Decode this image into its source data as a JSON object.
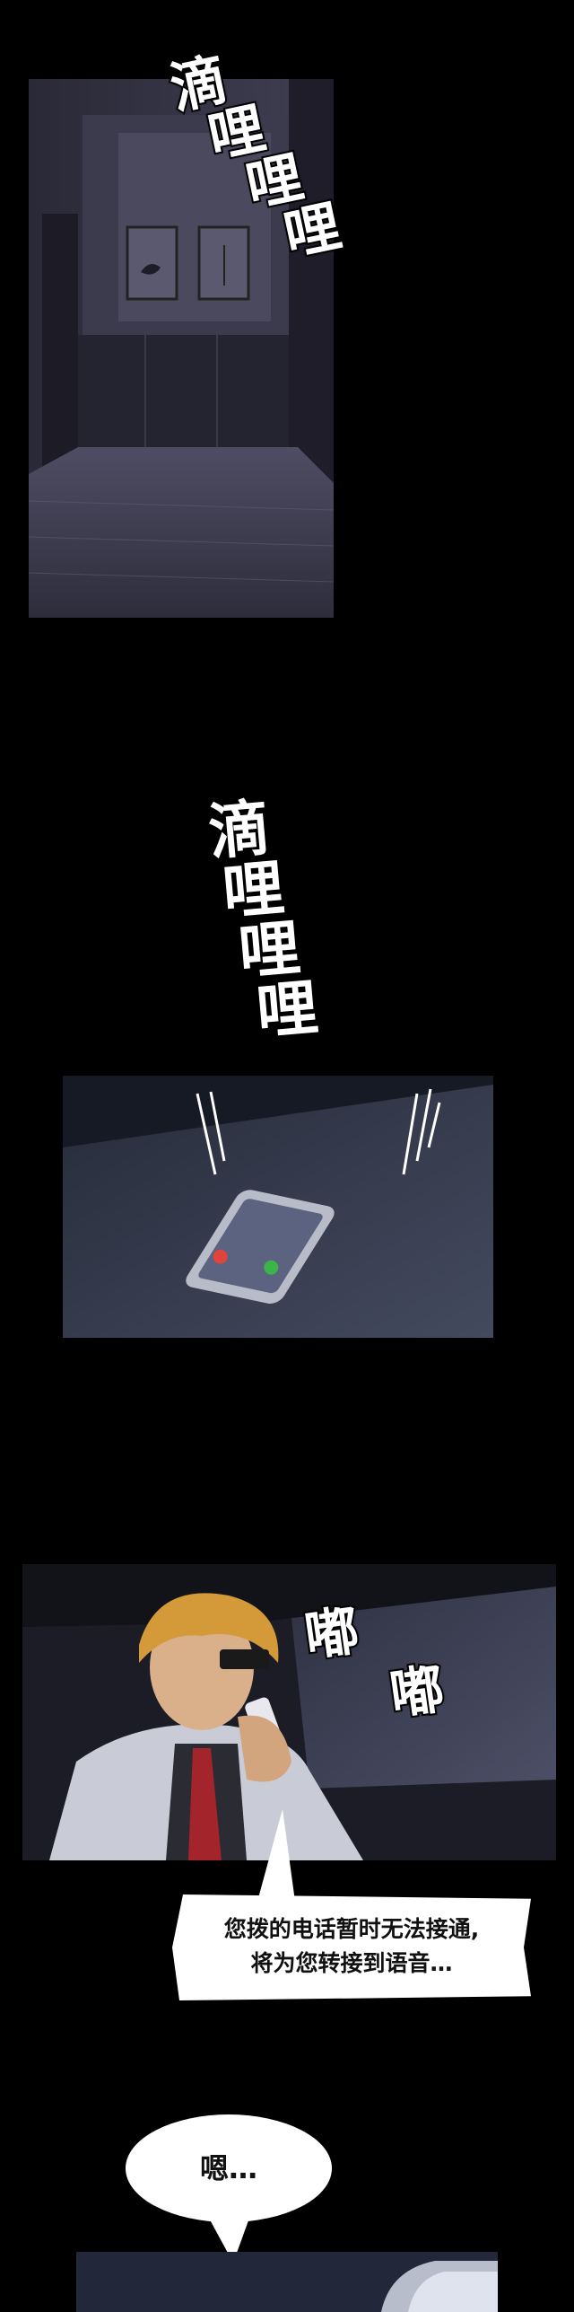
{
  "page": {
    "background": "#000000"
  },
  "panels": [
    {
      "name": "hallway-panel",
      "palette": [
        "#2b2a38",
        "#4a4860",
        "#6d6b82",
        "#1a1924"
      ]
    },
    {
      "name": "phone-on-table-panel",
      "palette": [
        "#1c2230",
        "#2f3445",
        "#555b70"
      ]
    },
    {
      "name": "man-calling-panel",
      "palette": [
        "#20222e",
        "#3a3c4e",
        "#c9a060"
      ]
    },
    {
      "name": "bottom-phone-panel",
      "palette": [
        "#24283a",
        "#525a78"
      ]
    }
  ],
  "sfx": {
    "ring_1": {
      "chars": [
        "滴",
        "哩",
        "哩",
        "哩"
      ]
    },
    "ring_2": {
      "chars": [
        "滴",
        "哩",
        "哩",
        "哩"
      ]
    },
    "dial_1": {
      "text": "嘟"
    },
    "dial_2": {
      "text": "嘟"
    }
  },
  "dialogue": {
    "operator_line_1": "您拨的电话暂时无法接通,",
    "operator_line_2": "将为您转接到语音…",
    "reply": "嗯…"
  },
  "phone_screen": {
    "decline_color": "#e0443a",
    "accept_color": "#3bb54a"
  }
}
